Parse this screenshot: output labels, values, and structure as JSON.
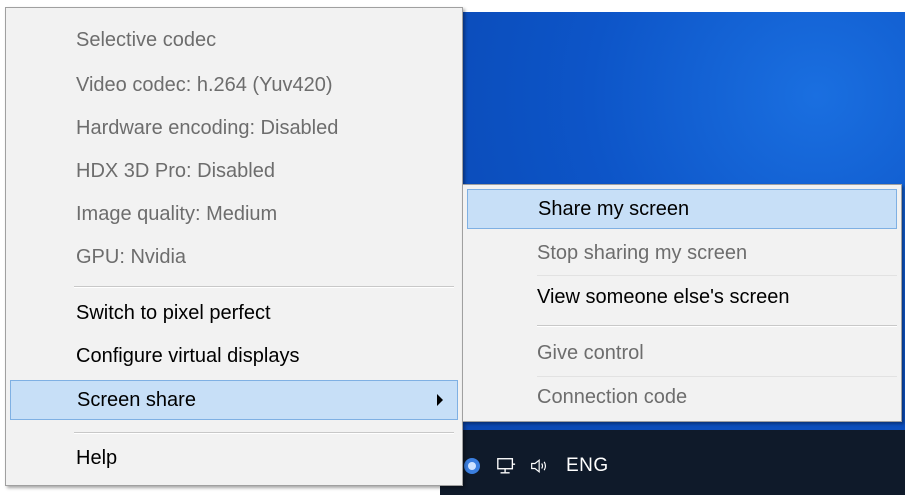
{
  "main_menu": {
    "items": [
      {
        "label": "Selective codec",
        "enabled": false
      },
      {
        "label": "Video codec: h.264 (Yuv420)",
        "enabled": false
      },
      {
        "label": "Hardware encoding: Disabled",
        "enabled": false
      },
      {
        "label": "HDX 3D Pro: Disabled",
        "enabled": false
      },
      {
        "label": "Image quality: Medium",
        "enabled": false
      },
      {
        "label": "GPU: Nvidia",
        "enabled": false
      },
      {
        "label": "Switch to pixel perfect",
        "enabled": true
      },
      {
        "label": "Configure virtual displays",
        "enabled": true
      },
      {
        "label": "Screen share",
        "enabled": true,
        "highlighted": true,
        "has_submenu": true
      },
      {
        "label": "Help",
        "enabled": true
      }
    ]
  },
  "submenu": {
    "items": [
      {
        "label": "Share my screen",
        "enabled": true,
        "highlighted": true
      },
      {
        "label": "Stop sharing my screen",
        "enabled": false
      },
      {
        "label": "View someone else's screen",
        "enabled": true
      },
      {
        "label": "Give control",
        "enabled": false
      },
      {
        "label": "Connection code",
        "enabled": false
      }
    ]
  },
  "taskbar": {
    "tray_icons": [
      "app-tray-icon",
      "network-icon",
      "volume-icon"
    ],
    "language": "ENG"
  },
  "colors": {
    "menu_bg": "#f2f2f2",
    "highlight_bg": "#c7dff7",
    "highlight_border": "#7fb0e3",
    "desktop_blue": "#0d55c8",
    "taskbar": "#0f1a2a",
    "disabled_text": "#6d6d6d"
  }
}
